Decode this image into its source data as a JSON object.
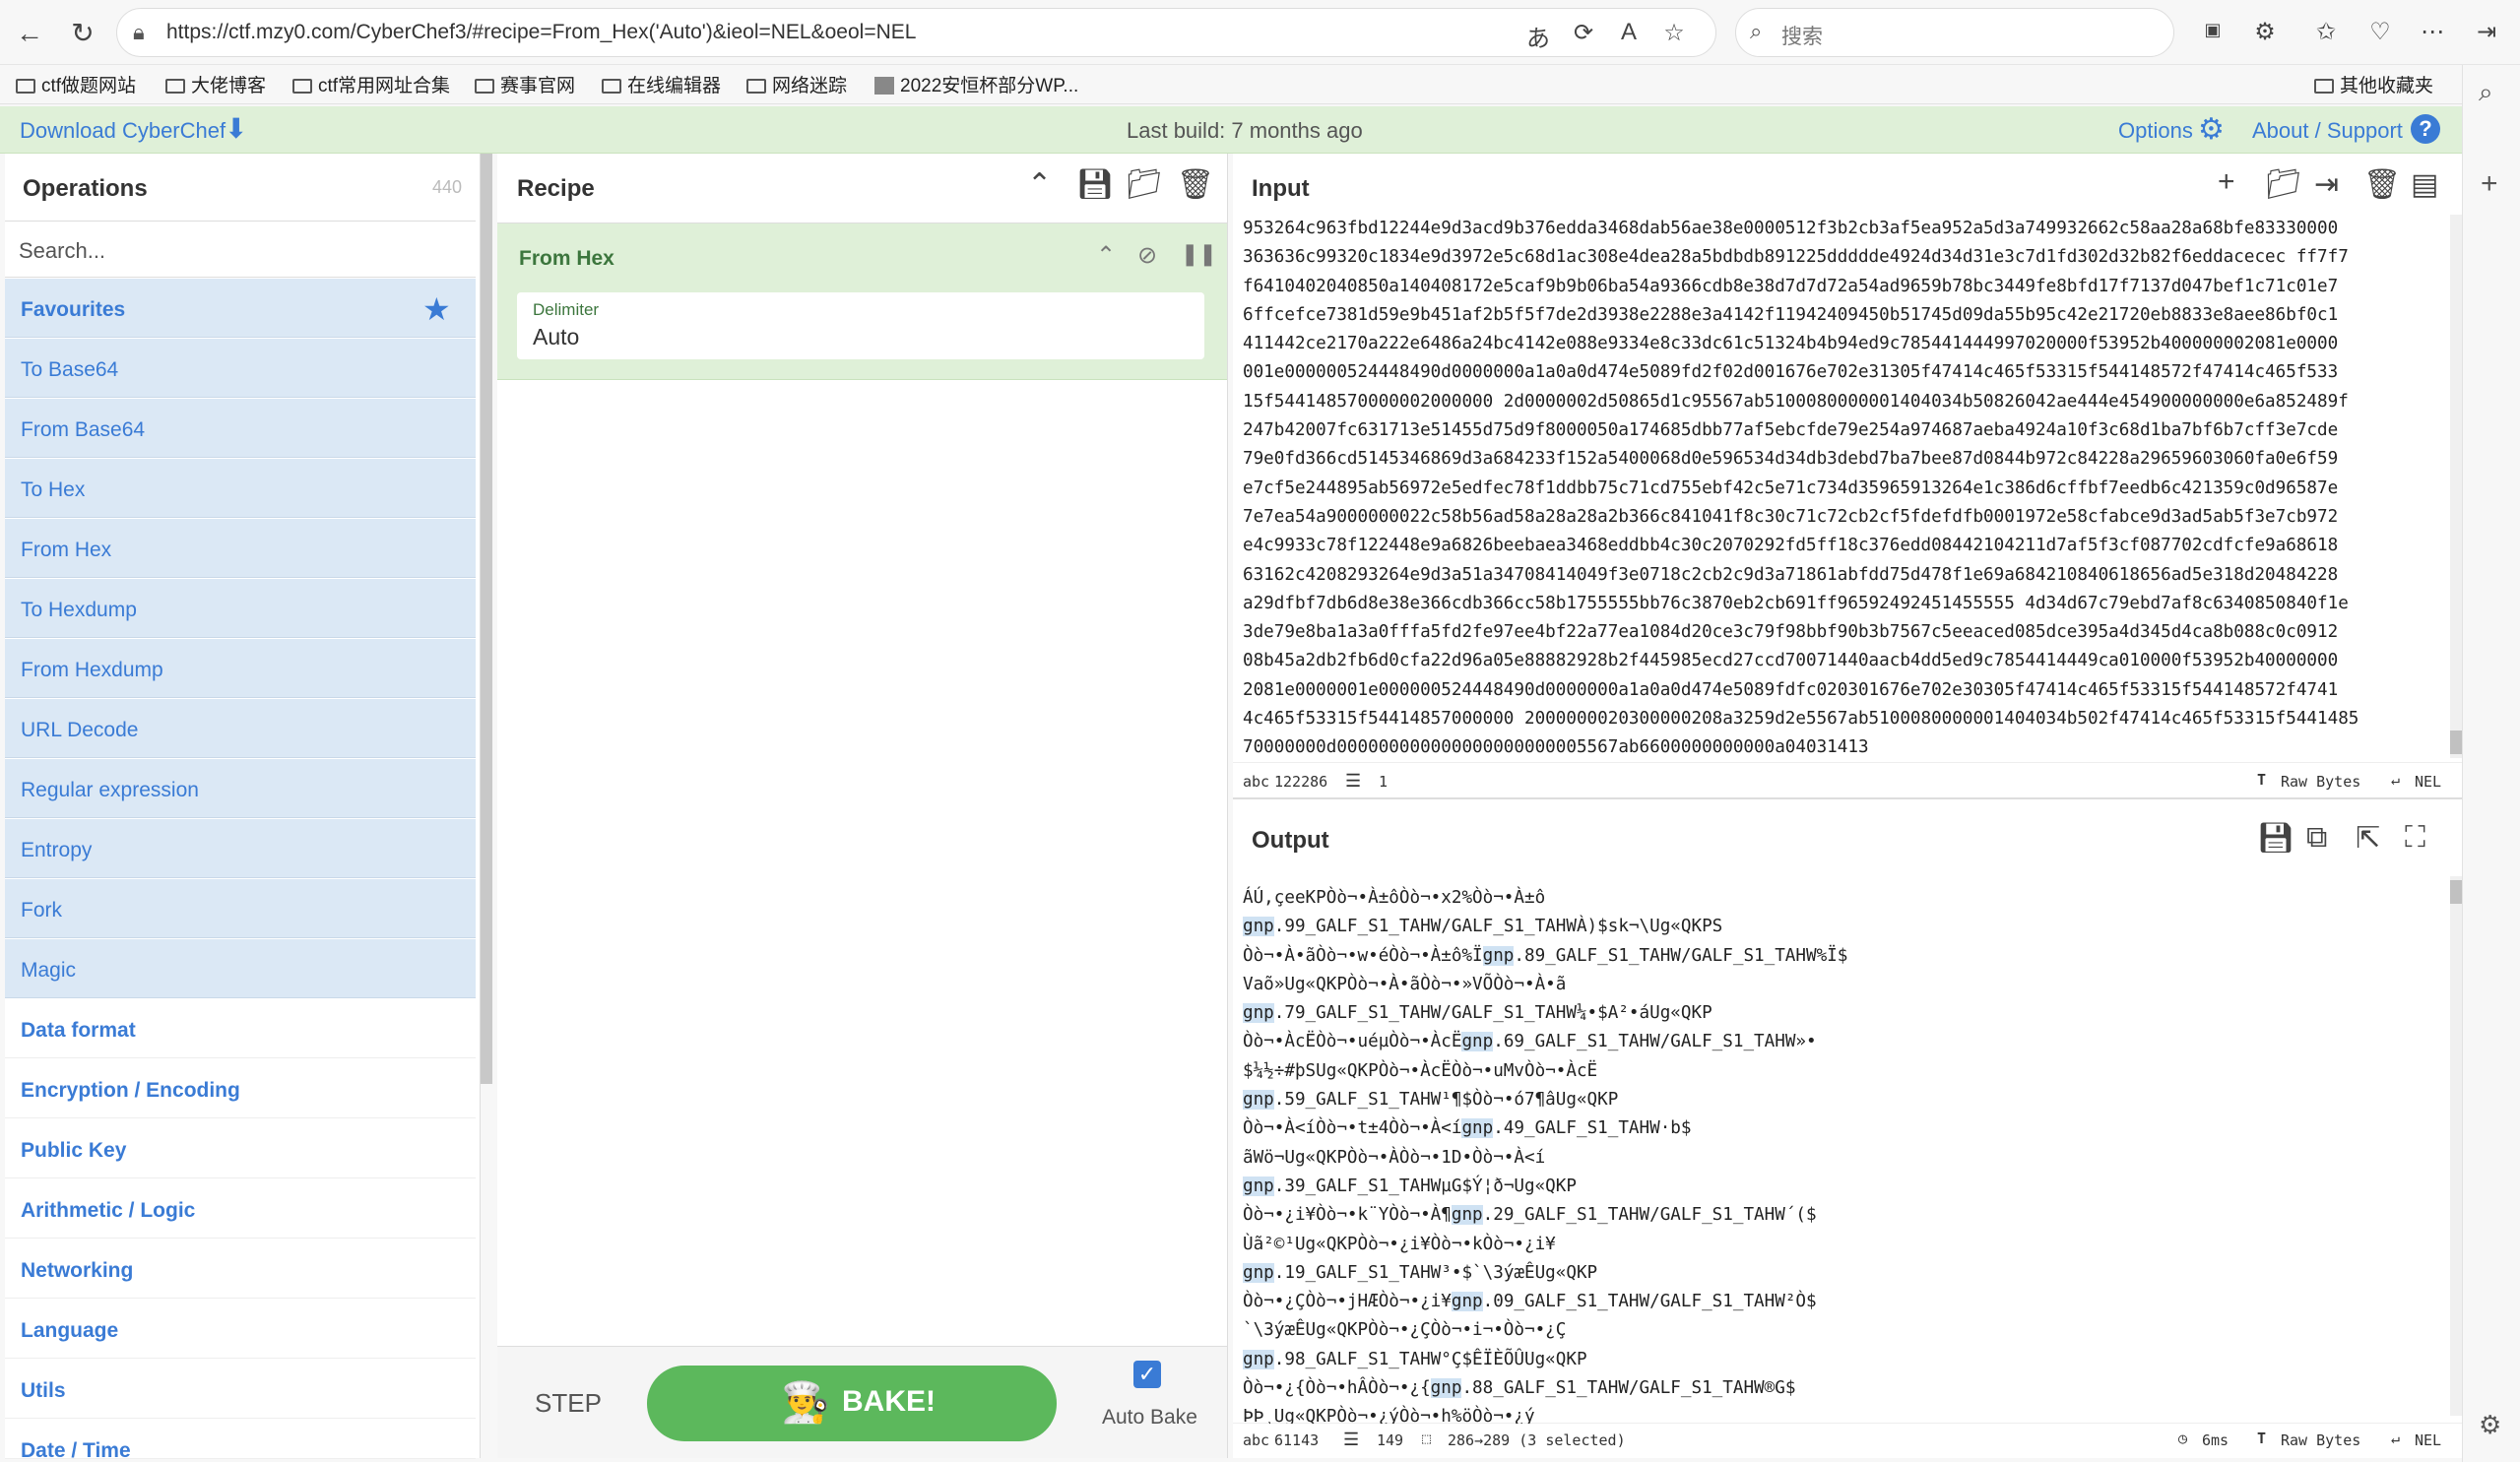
{
  "browser": {
    "url": "https://ctf.mzy0.com/CyberChef3/#recipe=From_Hex('Auto')&ieol=NEL&oeol=NEL",
    "search_placeholder": "搜索",
    "bookmarks": [
      "ctf做题网站",
      "大佬博客",
      "ctf常用网址合集",
      "赛事官网",
      "在线编辑器",
      "网络迷踪",
      "2022安恒杯部分WP...",
      "其他收藏夹"
    ]
  },
  "banner": {
    "download": "Download CyberChef",
    "last_build": "Last build: 7 months ago",
    "options": "Options",
    "about": "About / Support"
  },
  "operations": {
    "title": "Operations",
    "count": "440",
    "search_placeholder": "Search...",
    "favourites": "Favourites",
    "items": [
      "To Base64",
      "From Base64",
      "To Hex",
      "From Hex",
      "To Hexdump",
      "From Hexdump",
      "URL Decode",
      "Regular expression",
      "Entropy",
      "Fork",
      "Magic"
    ],
    "categories": [
      "Data format",
      "Encryption / Encoding",
      "Public Key",
      "Arithmetic / Logic",
      "Networking",
      "Language",
      "Utils",
      "Date / Time"
    ]
  },
  "recipe": {
    "title": "Recipe",
    "op_name": "From Hex",
    "delimiter_label": "Delimiter",
    "delimiter_value": "Auto",
    "step": "STEP",
    "bake": "BAKE!",
    "auto_bake": "Auto Bake"
  },
  "input": {
    "title": "Input",
    "lines": [
      "953264c963fbd12244e9d3acd9b376edda3468dab56ae38e0000512f3b2cb3af5ea952a5d3a749932662c58aa28a68bfe83330000",
      "363636c99320c1834e9d3972e5c68d1ac308e4dea28a5bdbdb891225ddddde4924d34d31e3c7d1fd302d32b82f6eddacecec ff7f7",
      "f6410402040850a140408172e5caf9b9b06ba54a9366cdb8e38d7d7d72a54ad9659b78bc3449fe8bfd17f7137d047bef1c71c01e7",
      "6ffcefce7381d59e9b451af2b5f5f7de2d3938e2288e3a4142f11942409450b51745d09da55b95c42e21720eb8833e8aee86bf0c1",
      "411442ce2170a222e6486a24bc4142e088e9334e8c33dc61c51324b4b94ed9c785441444997020000f53952b400000002081e0000",
      "001e000000524448490d0000000a1a0a0d474e5089fd2f02d001676e702e31305f47414c465f53315f544148572f47414c465f533",
      "15f544148570000002000000 2d0000002d50865d1c95567ab5100080000001404034b50826042ae444e454900000000e6a852489f",
      "247b42007fc631713e51455d75d9f8000050a174685dbb77af5ebcfde79e254a974687aeba4924a10f3c68d1ba7bf6b7cff3e7cde",
      "79e0fd366cd5145346869d3a684233f152a5400068d0e596534d34db3debd7ba7bee87d0844b972c84228a29659603060fa0e6f59",
      "e7cf5e244895ab56972e5edfec78f1ddbb75c71cd755ebf42c5e71c734d35965913264e1c386d6cffbf7eedb6c421359c0d96587e",
      "7e7ea54a9000000022c58b56ad58a28a28a2b366c841041f8c30c71c72cb2cf5fdefdfb0001972e58cfabce9d3ad5ab5f3e7cb972",
      "e4c9933c78f122448e9a6826beebaea3468eddbb4c30c2070292fd5ff18c376edd08442104211d7af5f3cf087702cdfcfe9a68618",
      "63162c4208293264e9d3a51a34708414049f3e0718c2cb2c9d3a71861abfdd75d478f1e69a684210840618656ad5e318d20484228",
      "a29dfbf7db6d8e38e366cdb366cc58b1755555bb76c3870eb2cb691ff96592492451455555 4d34d67c79ebd7af8c6340850840f1e",
      "3de79e8ba1a3a0fffa5fd2fe97ee4bf22a77ea1084d20ce3c79f98bbf90b3b7567c5eeaced085dce395a4d345d4ca8b088c0c0912",
      "08b45a2db2fb6d0cfa22d96a05e88882928b2f445985ecd27ccd70071440aacb4dd5ed9c7854414449ca010000f53952b40000000",
      "2081e0000001e000000524448490d0000000a1a0a0d474e5089fdfc020301676e702e30305f47414c465f53315f544148572f4741",
      "4c465f53315f54414857000000 2000000020300000208a3259d2e5567ab5100080000001404034b502f47414c465f53315f5441485",
      "70000000d000000000000000000000005567ab6600000000000a04031413"
    ],
    "length": "122286",
    "line_count": "1",
    "raw_bytes": "Raw Bytes",
    "eol": "NEL"
  },
  "output": {
    "title": "Output",
    "lines": [
      "ÁÚ,çeeKPÒò¬•À±ôÒò¬•x2%Òò¬•À±ô",
      "gnp.99_GALF_S1_TAHW/GALF_S1_TAHWÀ)$sk¬\\Ug«QKPS",
      "Òò¬•À•ãÒò¬•w•éÒò¬•À±ô%Ïgnp.89_GALF_S1_TAHW/GALF_S1_TAHW%Ï$",
      "Vaõ»Ug«QKPÒò¬•À•ãÒò¬•»VÕÒò¬•À•ã",
      "gnp.79_GALF_S1_TAHW/GALF_S1_TAHW¼•$A²•áUg«QKP",
      "Òò¬•ÀcËÒò¬•uéµÒò¬•ÀcËgnp.69_GALF_S1_TAHW/GALF_S1_TAHW»•",
      "$¼½÷#þSUg«QKPÒò¬•ÀcËÒò¬•uMvÒò¬•ÀcË",
      "gnp.59_GALF_S1_TAHW¹¶$Òò¬•ó7¶âUg«QKP",
      "Òò¬•À<íÒò¬•t±4Òò¬•À<ígnp.49_GALF_S1_TAHW·b$",
      "ãWö¬Ug«QKPÒò¬•ÀÒò¬•1D•Òò¬•À<í",
      "gnp.39_GALF_S1_TAHWµG$Ý¦ð¬Ug«QKP",
      "Òò¬•¿i¥Òò¬•k¨YÒò¬•À¶gnp.29_GALF_S1_TAHW/GALF_S1_TAHW´($",
      "Ùã²©¹Ug«QKPÒò¬•¿i¥Òò¬•kÒò¬•¿i¥",
      "gnp.19_GALF_S1_TAHW³•$`\\3ýæÊUg«QKP",
      "Òò¬•¿ÇÒò¬•jHÆÒò¬•¿i¥gnp.09_GALF_S1_TAHW/GALF_S1_TAHW²Ò$",
      "`\\3ýæÊUg«QKPÒò¬•¿ÇÒò¬•i¬•Òò¬•¿Ç",
      "gnp.98_GALF_S1_TAHW°Ç$ÊÏÈÕÛUg«QKP",
      "Òò¬•¿{Òò¬•hÂÒò¬•¿{gnp.88_GALF_S1_TAHW/GALF_S1_TAHW®G$",
      "ÞÞ¸Ug«QKPÒò¬•¿ýÒò¬•h%öÒò¬•¿ý"
    ],
    "length": "61143",
    "line_count": "149",
    "selection": "286→289 (3 selected)",
    "time": "6ms",
    "raw_bytes": "Raw Bytes",
    "eol": "NEL"
  }
}
